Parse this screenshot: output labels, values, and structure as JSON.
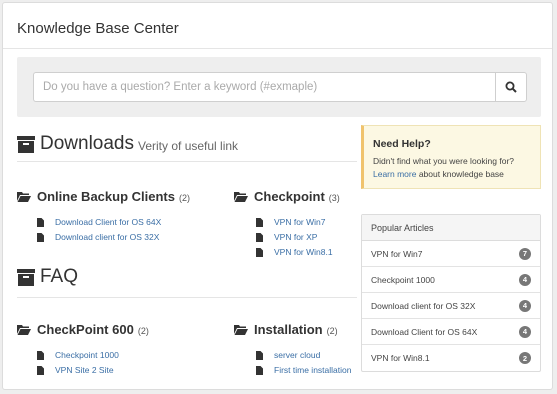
{
  "header": {
    "title": "Knowledge Base Center"
  },
  "search": {
    "placeholder": "Do you have a question? Enter a keyword (#exmaple)",
    "button_icon": "search-icon"
  },
  "downloads": {
    "title": "Downloads",
    "subtitle": "Verity of useful link",
    "icon": "archive-icon",
    "categories": [
      {
        "name": "Online Backup Clients",
        "count": "(2)",
        "articles": [
          "Download Client for OS 64X",
          "Download client for OS 32X"
        ]
      },
      {
        "name": "Checkpoint",
        "count": "(3)",
        "articles": [
          "VPN for Win7",
          "VPN for XP",
          "VPN for Win8.1"
        ]
      }
    ]
  },
  "faq": {
    "title": "FAQ",
    "icon": "archive-icon",
    "categories": [
      {
        "name": "CheckPoint 600",
        "count": "(2)",
        "articles": [
          "Checkpoint 1000",
          "VPN Site 2 Site"
        ]
      },
      {
        "name": "Installation",
        "count": "(2)",
        "articles": [
          "server cloud",
          "First time installation"
        ]
      }
    ]
  },
  "help": {
    "title": "Need Help?",
    "line1": "Didn't find what you were looking for?",
    "link": "Learn more",
    "line2_rest": " about knowledge base",
    "accent_color": "#f0c36d",
    "background_color": "#fcf8e3"
  },
  "popular": {
    "title": "Popular Articles",
    "items": [
      {
        "label": "VPN for Win7",
        "count": "7"
      },
      {
        "label": "Checkpoint 1000",
        "count": "4"
      },
      {
        "label": "Download client for OS 32X",
        "count": "4"
      },
      {
        "label": "Download Client for OS 64X",
        "count": "4"
      },
      {
        "label": "VPN for Win8.1",
        "count": "2"
      }
    ]
  },
  "colors": {
    "link": "#3a6ea5",
    "badge": "#777777"
  }
}
